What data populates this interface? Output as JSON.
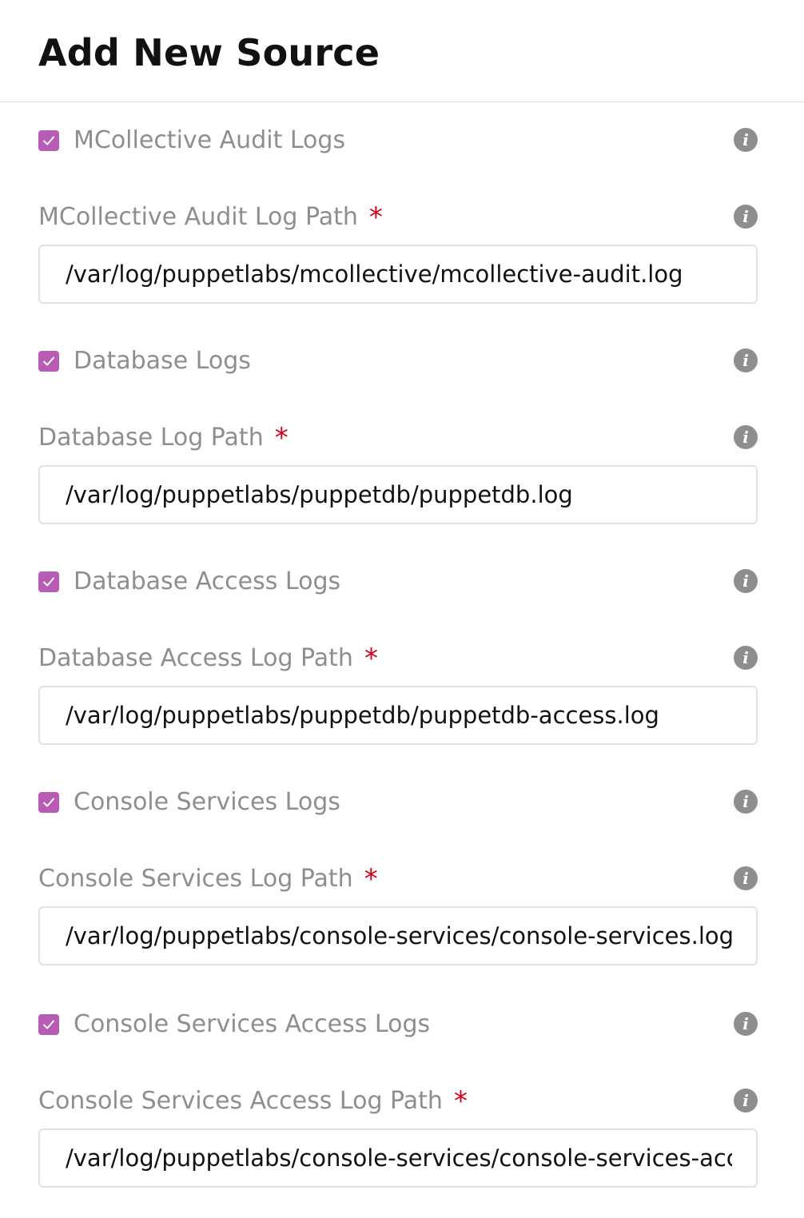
{
  "header": {
    "title": "Add New Source"
  },
  "colors": {
    "checkbox_accent": "#b85bb4",
    "required_marker": "#d0021b",
    "muted_text": "#8e8e8e",
    "info_icon": "#8e8e8e"
  },
  "icons": {
    "info": "info-icon",
    "check": "checkmark-icon"
  },
  "form": {
    "sections": [
      {
        "checkbox_label": "MCollective Audit Logs",
        "checked": true,
        "path_label": "MCollective Audit Log Path",
        "required_marker": "*",
        "path_value": "/var/log/puppetlabs/mcollective/mcollective-audit.log"
      },
      {
        "checkbox_label": "Database Logs",
        "checked": true,
        "path_label": "Database Log Path",
        "required_marker": "*",
        "path_value": "/var/log/puppetlabs/puppetdb/puppetdb.log"
      },
      {
        "checkbox_label": "Database Access Logs",
        "checked": true,
        "path_label": "Database Access Log Path",
        "required_marker": "*",
        "path_value": "/var/log/puppetlabs/puppetdb/puppetdb-access.log"
      },
      {
        "checkbox_label": "Console Services Logs",
        "checked": true,
        "path_label": "Console Services Log Path",
        "required_marker": "*",
        "path_value": "/var/log/puppetlabs/console-services/console-services.log"
      },
      {
        "checkbox_label": "Console Services Access Logs",
        "checked": true,
        "path_label": "Console Services Access Log Path",
        "required_marker": "*",
        "path_value": "/var/log/puppetlabs/console-services/console-services-access.log"
      }
    ]
  }
}
